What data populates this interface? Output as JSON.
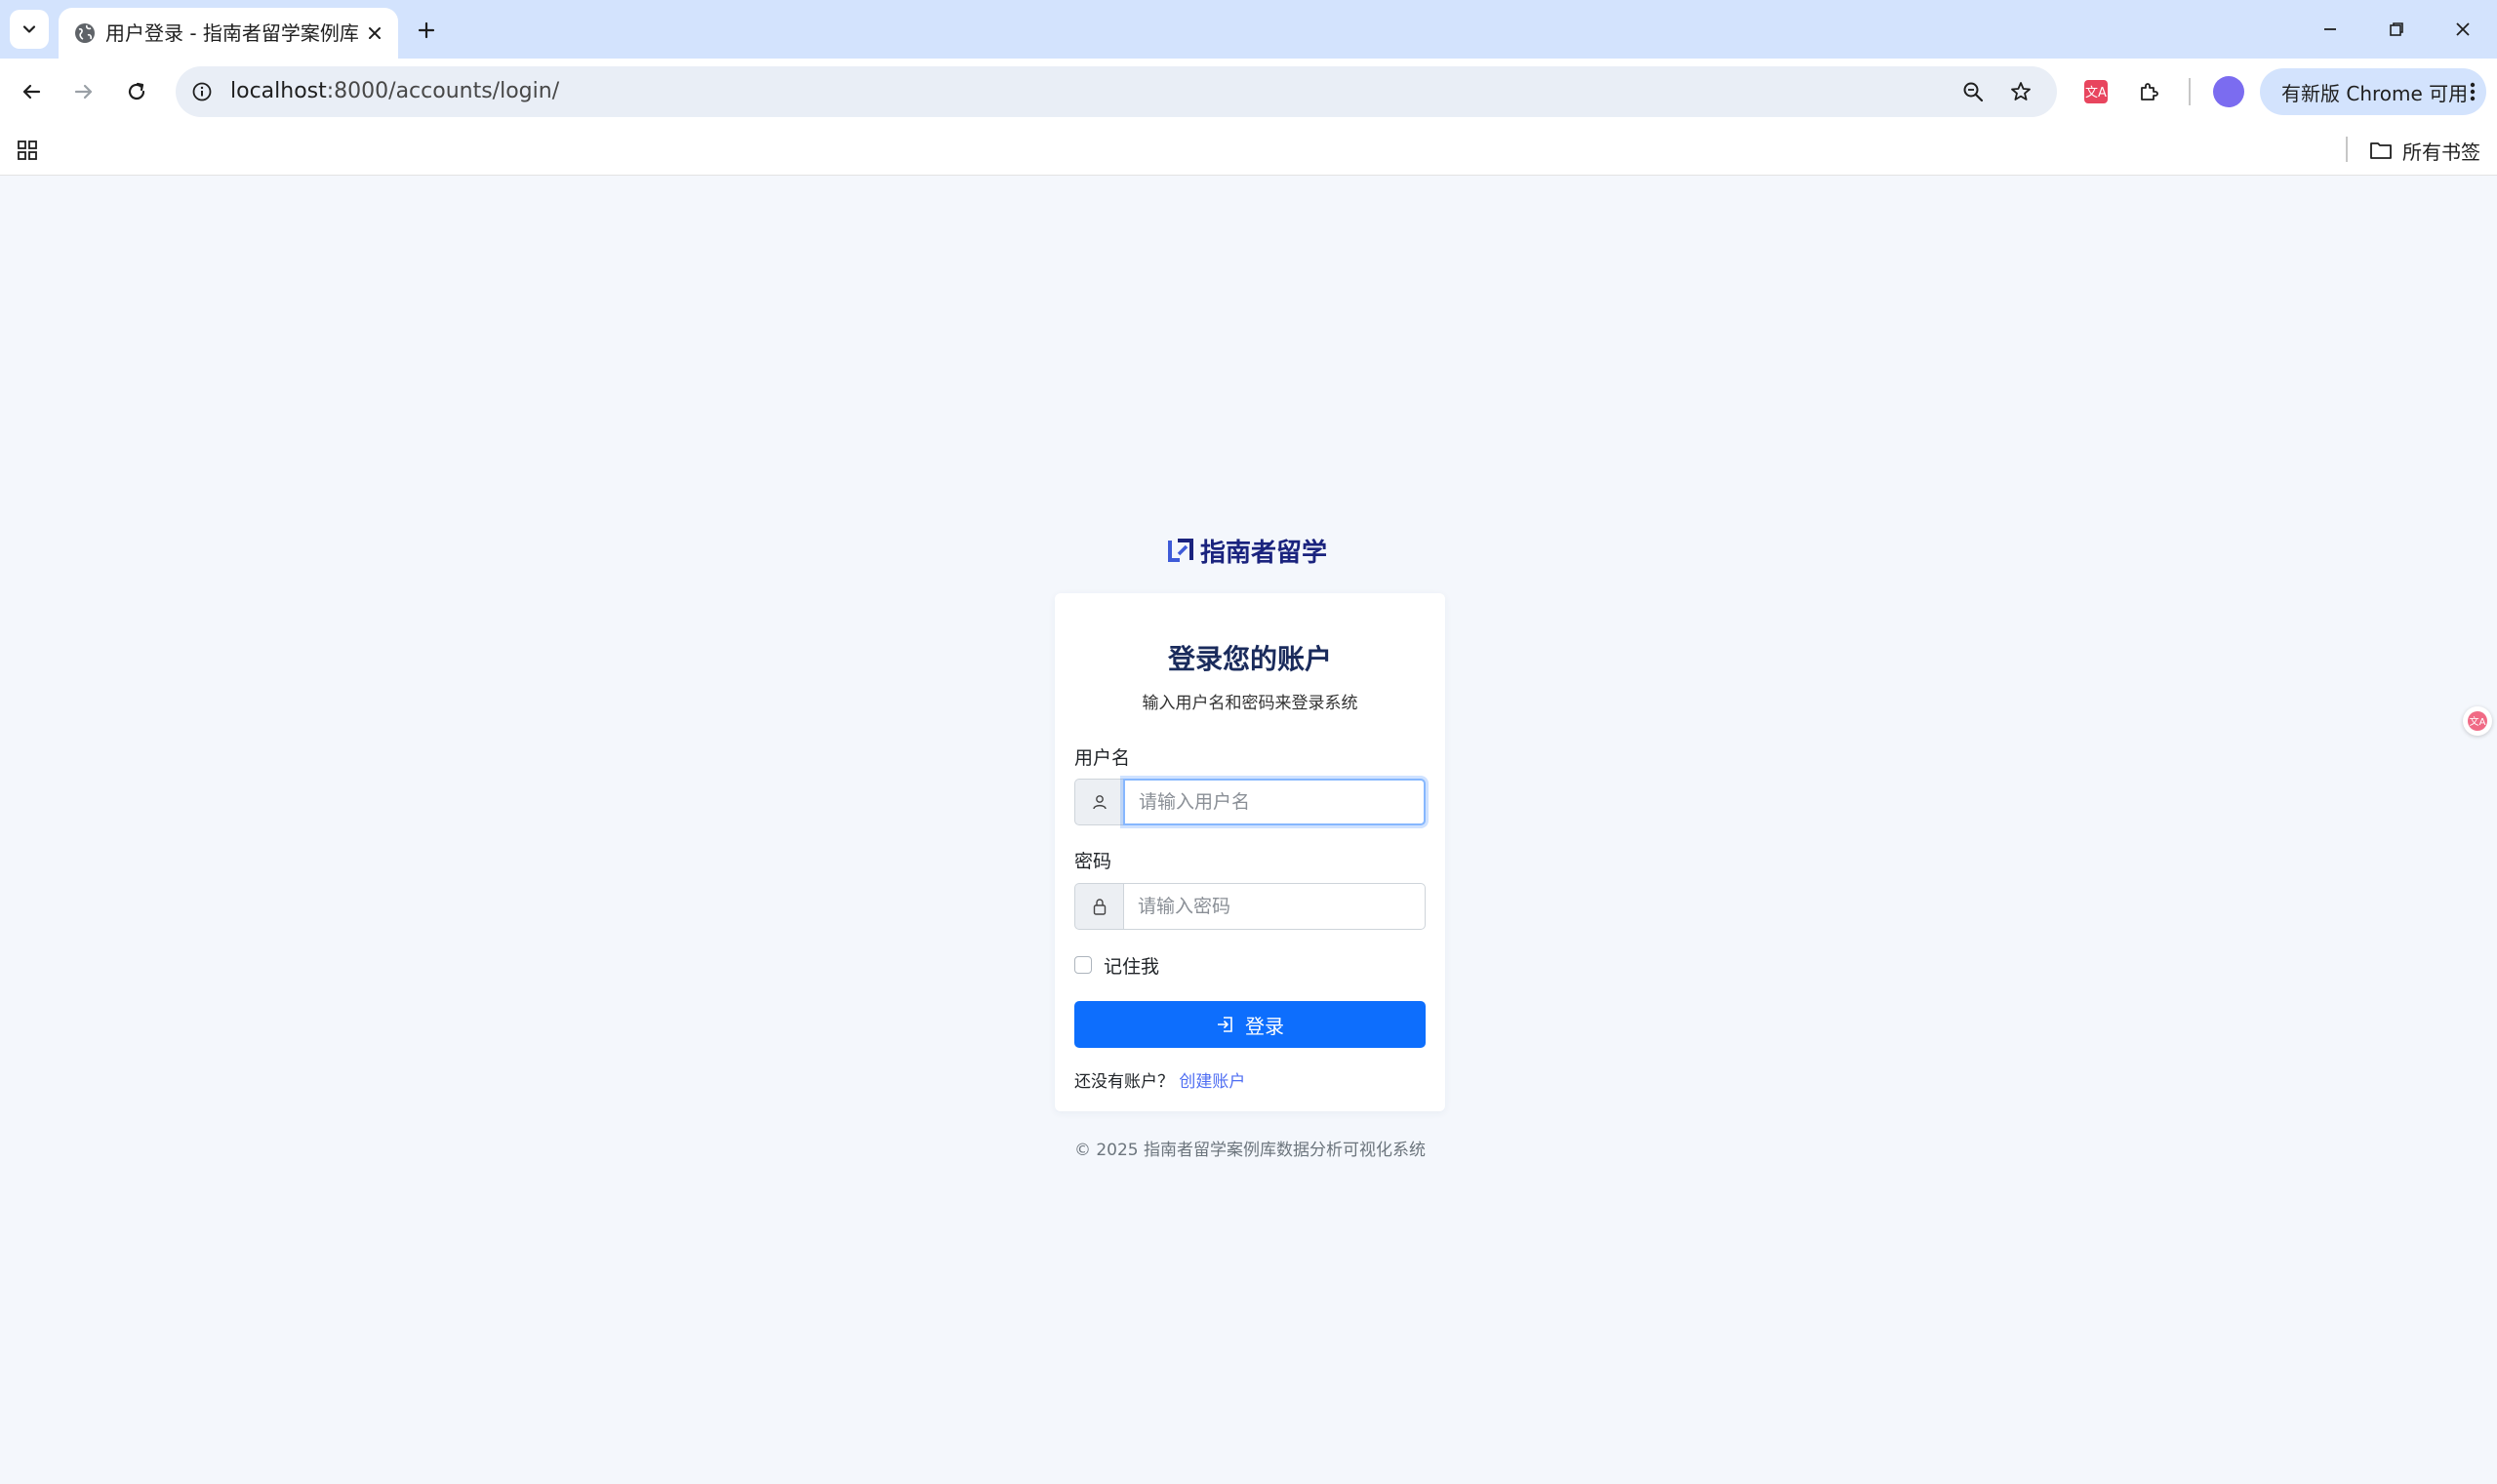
{
  "browser": {
    "tab": {
      "title": "用户登录 - 指南者留学案例库"
    },
    "address": {
      "host": "localhost",
      "path": ":8000/accounts/login/"
    },
    "update_button": "有新版 Chrome 可用",
    "bookmarks": {
      "all_bookmarks_label": "所有书签"
    },
    "colors": {
      "tabstrip": "#d3e3fd",
      "omnibox": "#e9eef6"
    }
  },
  "page": {
    "brand": {
      "name": "指南者留学",
      "color": "#1a237e"
    },
    "login_card": {
      "title": "登录您的账户",
      "subtitle": "输入用户名和密码来登录系统",
      "username": {
        "label": "用户名",
        "placeholder": "请输入用户名",
        "value": ""
      },
      "password": {
        "label": "密码",
        "placeholder": "请输入密码",
        "value": ""
      },
      "remember_me": {
        "label": "记住我",
        "checked": false
      },
      "submit_label": "登录",
      "signup_prompt": "还没有账户？",
      "signup_link": "创建账户"
    },
    "footer": "© 2025 指南者留学案例库数据分析可视化系统",
    "colors": {
      "background": "#f4f7fc",
      "primary": "#0d6efd",
      "link": "#4f6ef2"
    }
  }
}
